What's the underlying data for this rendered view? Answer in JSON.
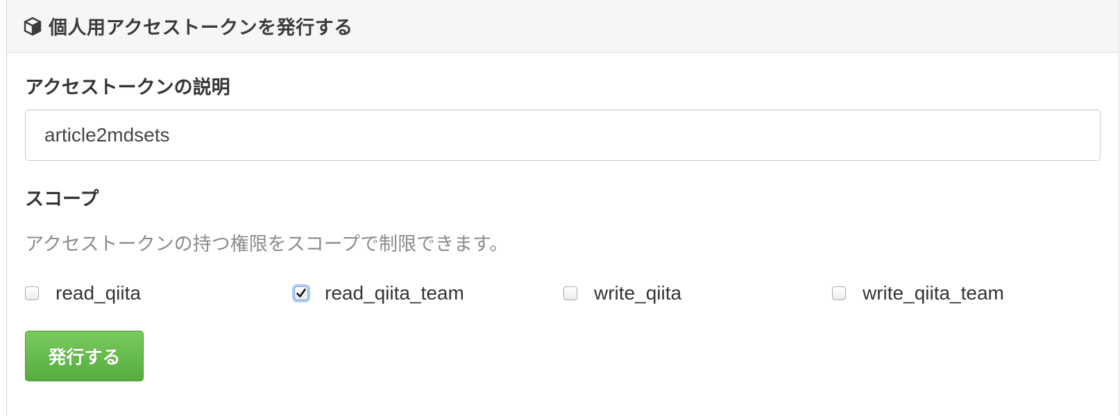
{
  "panel": {
    "title": "個人用アクセストークンを発行する",
    "icon": "cube-icon"
  },
  "form": {
    "description_label": "アクセストークンの説明",
    "description_value": "article2mdsets",
    "scope_label": "スコープ",
    "scope_help": "アクセストークンの持つ権限をスコープで制限できます。",
    "scopes": [
      {
        "label": "read_qiita",
        "checked": false
      },
      {
        "label": "read_qiita_team",
        "checked": true
      },
      {
        "label": "write_qiita",
        "checked": false
      },
      {
        "label": "write_qiita_team",
        "checked": false
      }
    ],
    "submit_label": "発行する"
  },
  "colors": {
    "button_green": "#5cb646",
    "help_text_gray": "#8b8b8b",
    "heading_bg": "#f6f6f6",
    "focus_ring": "#a8cdfb"
  }
}
